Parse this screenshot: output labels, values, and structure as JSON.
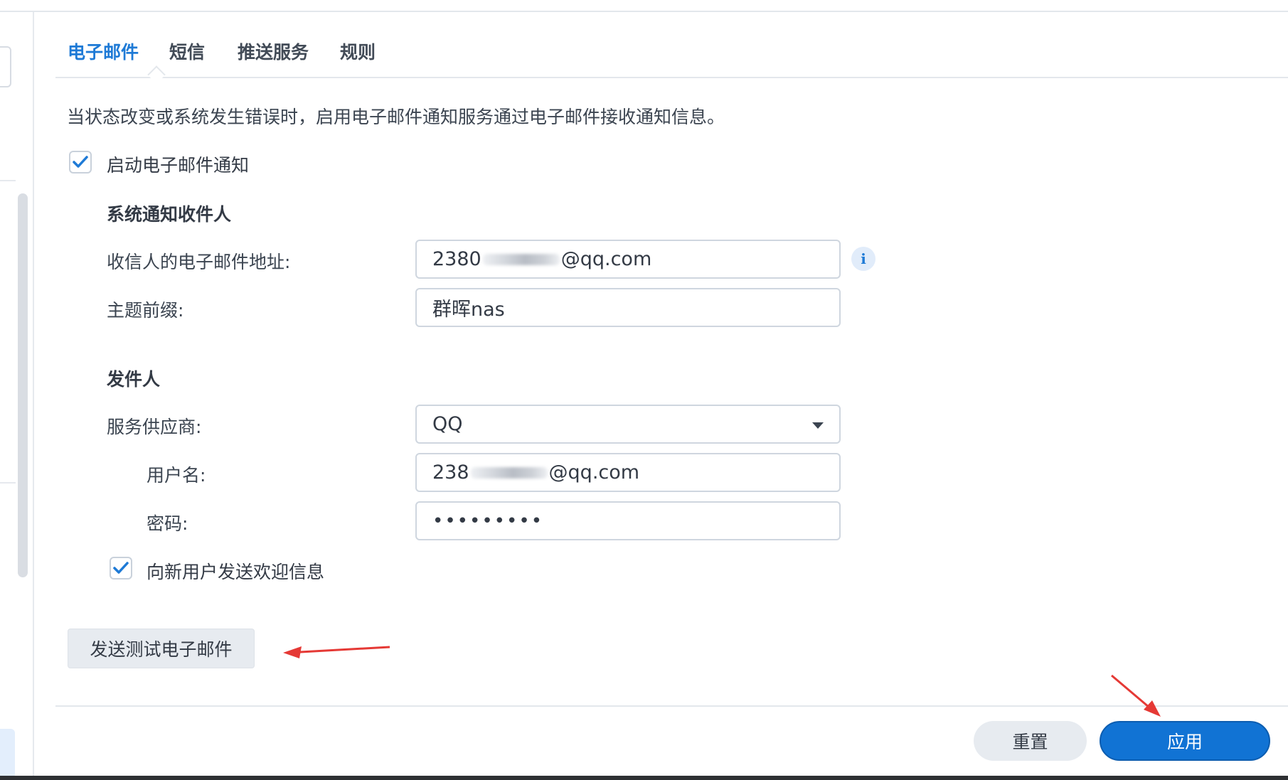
{
  "tabs": [
    {
      "label": "电子邮件",
      "active": true
    },
    {
      "label": "短信",
      "active": false
    },
    {
      "label": "推送服务",
      "active": false
    },
    {
      "label": "规则",
      "active": false
    }
  ],
  "description": "当状态改变或系统发生错误时，启用电子邮件通知服务通过电子邮件接收通知信息。",
  "enable_email": {
    "label": "启动电子邮件通知",
    "checked": true
  },
  "recipients": {
    "title": "系统通知收件人",
    "email_label": "收信人的电子邮件地址:",
    "email_value_prefix": "2380",
    "email_value_suffix": "@qq.com",
    "subject_label": "主题前缀:",
    "subject_value": "群晖nas"
  },
  "sender": {
    "title": "发件人",
    "provider_label": "服务供应商:",
    "provider_value": "QQ",
    "username_label": "用户名:",
    "username_value_prefix": "238",
    "username_value_suffix": "@qq.com",
    "password_label": "密码:",
    "password_value": "•••••••••",
    "welcome": {
      "label": "向新用户发送欢迎信息",
      "checked": true
    }
  },
  "buttons": {
    "send_test": "发送测试电子邮件",
    "reset": "重置",
    "apply": "应用"
  },
  "icons": {
    "info": "info-icon",
    "check": "check-icon",
    "dropdown": "chevron-down-icon"
  },
  "colors": {
    "accent": "#1e7ad6",
    "primary_button": "#1173d4",
    "annotation_arrow": "#e53935"
  }
}
